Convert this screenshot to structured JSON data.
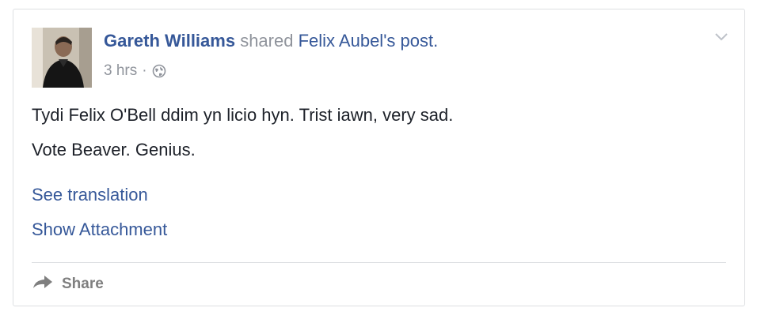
{
  "post": {
    "author_name": "Gareth Williams",
    "action_text": " shared ",
    "shared_source": "Felix Aubel's post.",
    "timestamp": "3 hrs",
    "separator": "·",
    "privacy_icon": "globe-icon",
    "body_lines": [
      "Tydi Felix O'Bell ddim yn licio hyn. Trist iawn, very sad.",
      "Vote Beaver. Genius."
    ],
    "see_translation_label": "See translation",
    "show_attachment_label": "Show Attachment"
  },
  "actions": {
    "share_label": "Share",
    "share_icon": "share-arrow-icon"
  },
  "menu": {
    "icon": "chevron-down-icon"
  },
  "colors": {
    "link": "#365899",
    "meta": "#90949c",
    "text": "#1d2129",
    "border": "#dddfe2",
    "action": "#7f7f7f"
  }
}
